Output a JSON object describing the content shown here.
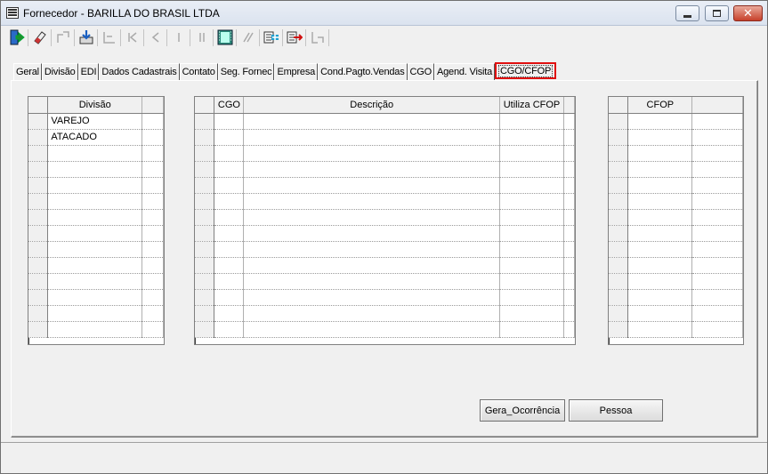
{
  "window": {
    "title": "Fornecedor - BARILLA DO BRASIL LTDA",
    "close_glyph": "✕"
  },
  "toolbar": {
    "icons": [
      "exit-door-icon",
      "eraser-icon",
      "disabled-icon",
      "save-icon",
      "disabled-icon",
      "first-record-icon",
      "previous-record-icon",
      "next-record-icon",
      "last-record-icon",
      "film-icon",
      "edit-icon",
      "add-record-icon",
      "delete-record-icon",
      "disabled-icon"
    ]
  },
  "tabs": [
    {
      "label": "Geral"
    },
    {
      "label": "Divisão"
    },
    {
      "label": "EDI"
    },
    {
      "label": "Dados Cadastrais"
    },
    {
      "label": "Contato"
    },
    {
      "label": "Seg. Fornec"
    },
    {
      "label": "Empresa"
    },
    {
      "label": "Cond.Pagto.Vendas"
    },
    {
      "label": "CGO"
    },
    {
      "label": "Agend. Visita"
    },
    {
      "label": "CGO/CFOP"
    }
  ],
  "grid_divisao": {
    "header": "Divisão",
    "rows": [
      "VAREJO",
      "ATACADO",
      "",
      "",
      "",
      "",
      "",
      "",
      "",
      "",
      "",
      "",
      "",
      ""
    ]
  },
  "grid_cgo": {
    "headers": [
      "CGO",
      "Descrição",
      "Utiliza CFOP"
    ],
    "row_count": 14
  },
  "grid_cfop": {
    "header": "CFOP",
    "row_count": 14
  },
  "buttons": {
    "gera_ocorrencia": "Gera_Ocorrência",
    "pessoa": "Pessoa"
  },
  "colors": {
    "active_tab_highlight": "#e01010"
  }
}
